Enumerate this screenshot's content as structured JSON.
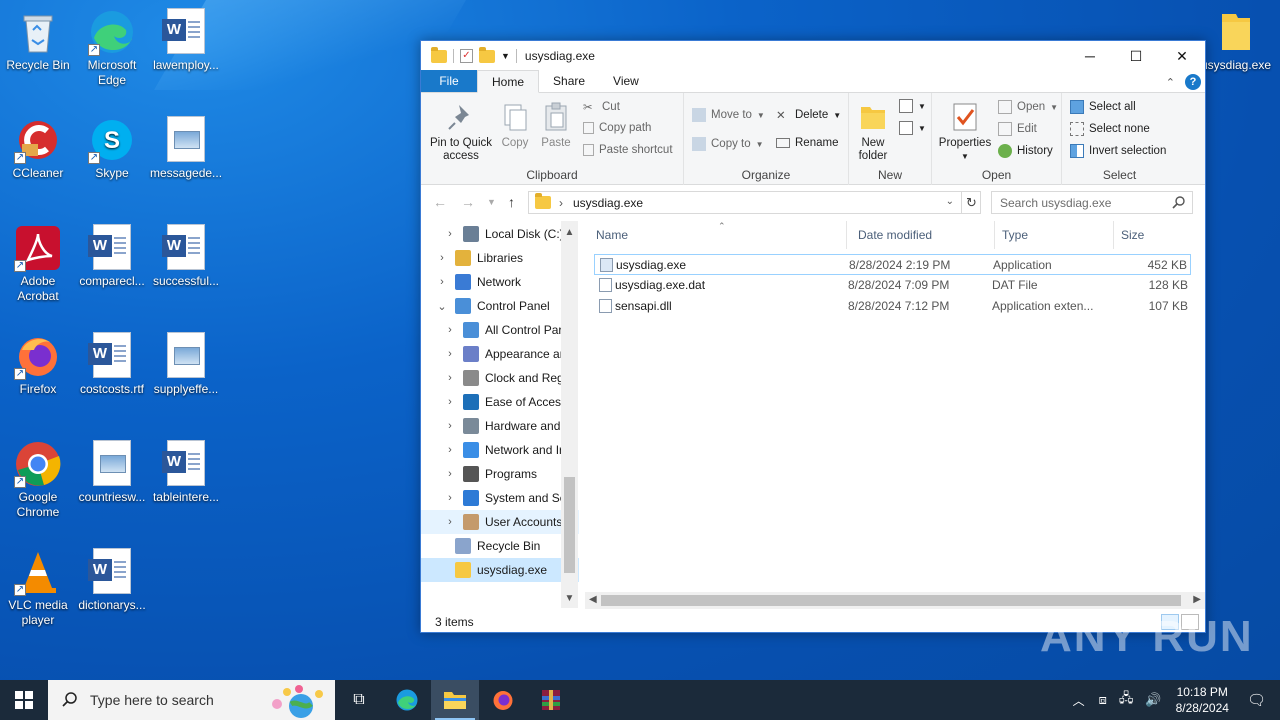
{
  "desktop": {
    "icons": [
      {
        "label": "Recycle Bin"
      },
      {
        "label": "Microsoft Edge"
      },
      {
        "label": "lawemploy..."
      },
      {
        "label": "CCleaner"
      },
      {
        "label": "Skype"
      },
      {
        "label": "messagede..."
      },
      {
        "label": "Adobe Acrobat"
      },
      {
        "label": "comparecl..."
      },
      {
        "label": "successful..."
      },
      {
        "label": "Firefox"
      },
      {
        "label": "costcosts.rtf"
      },
      {
        "label": "supplyeffe..."
      },
      {
        "label": "Google Chrome"
      },
      {
        "label": "countriesw..."
      },
      {
        "label": "tableintere..."
      },
      {
        "label": "VLC media player"
      },
      {
        "label": "dictionarys..."
      },
      {
        "label": "usysdiag.exe"
      }
    ],
    "watermark": "ANY RUN"
  },
  "explorer": {
    "title": "usysdiag.exe",
    "tabs": [
      "File",
      "Home",
      "Share",
      "View"
    ],
    "ribbon": {
      "clipboard": {
        "name": "Clipboard",
        "pin": "Pin to Quick access",
        "copy": "Copy",
        "paste": "Paste",
        "cut": "Cut",
        "copy_path": "Copy path",
        "paste_shortcut": "Paste shortcut"
      },
      "organize": {
        "name": "Organize",
        "move_to": "Move to",
        "copy_to": "Copy to",
        "delete": "Delete",
        "rename": "Rename"
      },
      "new": {
        "name": "New",
        "new_folder": "New folder"
      },
      "open": {
        "name": "Open",
        "properties": "Properties",
        "open": "Open",
        "edit": "Edit",
        "history": "History"
      },
      "select": {
        "name": "Select",
        "select_all": "Select all",
        "select_none": "Select none",
        "invert": "Invert selection"
      }
    },
    "address": "usysdiag.exe",
    "search_placeholder": "Search usysdiag.exe",
    "nav": [
      {
        "label": "Local Disk (C:)",
        "chev": "›",
        "indent": 1
      },
      {
        "label": "Libraries",
        "chev": "›",
        "indent": 0
      },
      {
        "label": "Network",
        "chev": "›",
        "indent": 0
      },
      {
        "label": "Control Panel",
        "chev": "⌄",
        "indent": 0
      },
      {
        "label": "All Control Par",
        "chev": "›",
        "indent": 1
      },
      {
        "label": "Appearance an",
        "chev": "›",
        "indent": 1
      },
      {
        "label": "Clock and Regi",
        "chev": "›",
        "indent": 1
      },
      {
        "label": "Ease of Access",
        "chev": "›",
        "indent": 1
      },
      {
        "label": "Hardware and",
        "chev": "›",
        "indent": 1
      },
      {
        "label": "Network and Ir",
        "chev": "›",
        "indent": 1
      },
      {
        "label": "Programs",
        "chev": "›",
        "indent": 1
      },
      {
        "label": "System and Sec",
        "chev": "›",
        "indent": 1
      },
      {
        "label": "User Accounts",
        "chev": "›",
        "indent": 1
      },
      {
        "label": "Recycle Bin",
        "chev": "",
        "indent": 0
      },
      {
        "label": "usysdiag.exe",
        "chev": "",
        "indent": 0
      }
    ],
    "columns": [
      "Name",
      "Date modified",
      "Type",
      "Size"
    ],
    "files": [
      {
        "name": "usysdiag.exe",
        "date": "8/28/2024 2:19 PM",
        "type": "Application",
        "size": "452 KB"
      },
      {
        "name": "usysdiag.exe.dat",
        "date": "8/28/2024 7:09 PM",
        "type": "DAT File",
        "size": "128 KB"
      },
      {
        "name": "sensapi.dll",
        "date": "8/28/2024 7:12 PM",
        "type": "Application exten...",
        "size": "107 KB"
      }
    ],
    "status": "3 items"
  },
  "taskbar": {
    "search_placeholder": "Type here to search",
    "time": "10:18 PM",
    "date": "8/28/2024"
  },
  "colors": {
    "accent": "#1979ca",
    "selection": "#cce8ff",
    "taskbar": "#1b2a3a"
  }
}
